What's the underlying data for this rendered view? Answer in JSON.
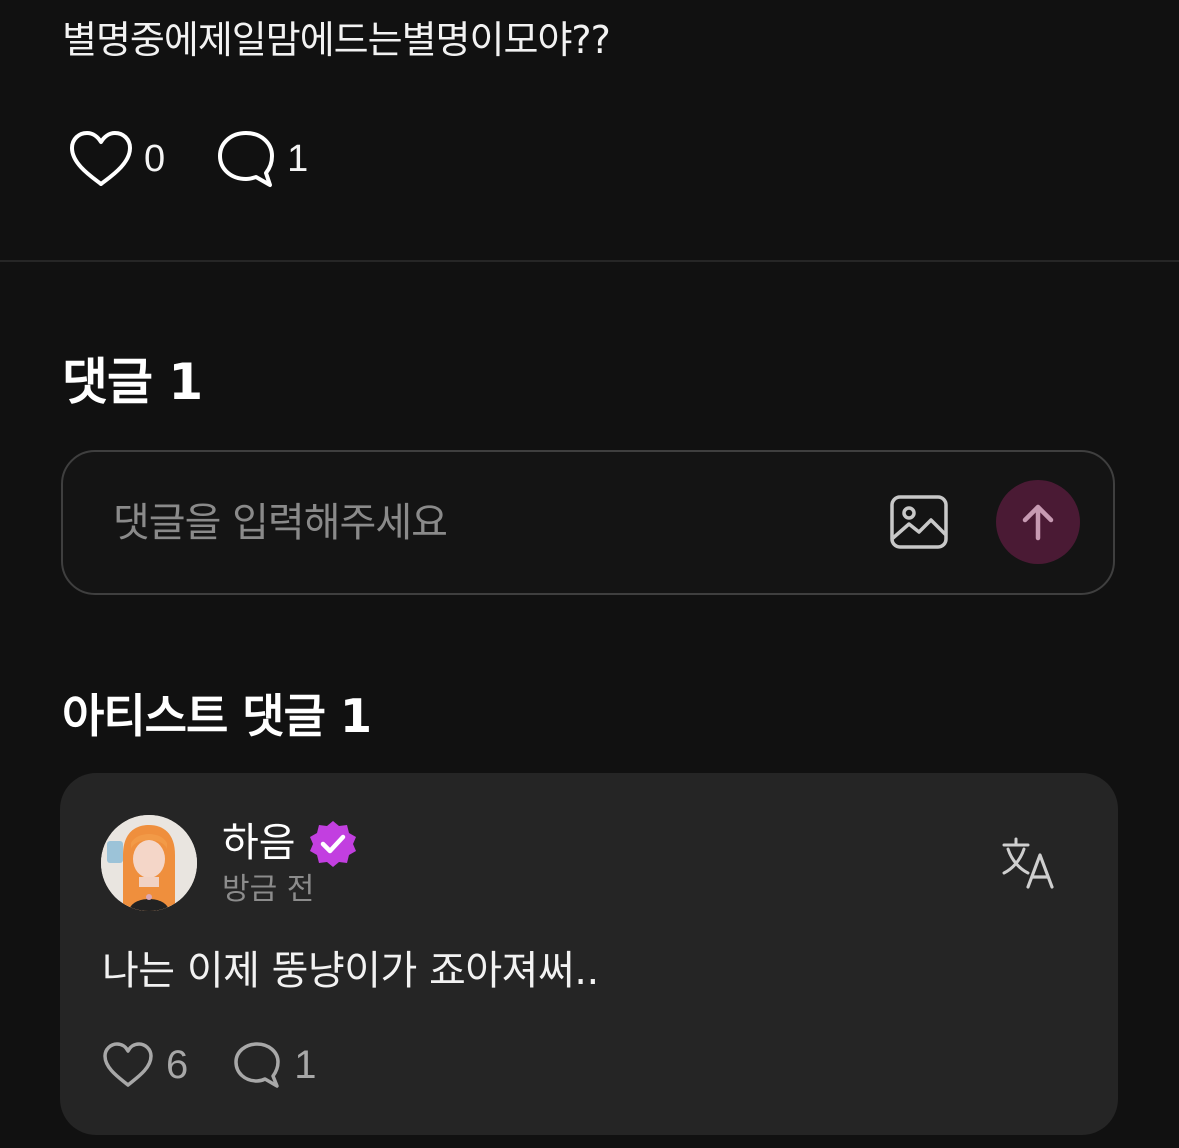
{
  "post": {
    "text": "별명중에제일맘에드는별명이모야??",
    "like_count": "0",
    "comment_count": "1"
  },
  "comments_section": {
    "title": "댓글 1"
  },
  "comment_input": {
    "placeholder": "댓글을 입력해주세요"
  },
  "artist_section": {
    "title": "아티스트 댓글 1"
  },
  "artist_comment": {
    "author": "하음",
    "timestamp": "방금 전",
    "text": "나는 이제 뚱냥이가 죠아져써..",
    "like_count": "6",
    "reply_count": "1"
  },
  "colors": {
    "background": "#111111",
    "card_background": "#252525",
    "send_button": "#4a1a34",
    "verified_badge": "#c23fe0"
  },
  "icons": {
    "like": "heart-icon",
    "comment": "speech-bubble-icon",
    "attach": "image-icon",
    "send": "arrow-up-icon",
    "verified": "verified-badge-icon",
    "translate": "translate-icon"
  }
}
